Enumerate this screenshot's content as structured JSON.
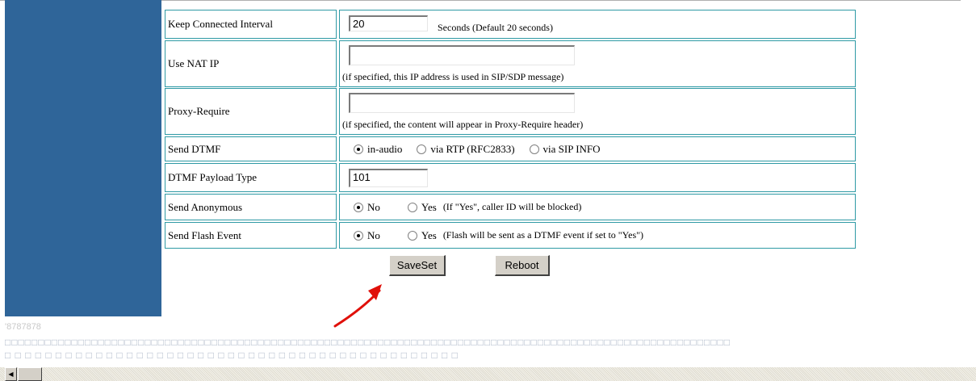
{
  "form": {
    "keep_connected": {
      "label": "Keep Connected Interval",
      "value": "20",
      "suffix": "Seconds (Default 20 seconds)"
    },
    "use_nat_ip": {
      "label": "Use NAT IP",
      "value": "",
      "hint": "(if specified, this IP address is used in SIP/SDP message)"
    },
    "proxy_require": {
      "label": "Proxy-Require",
      "value": "",
      "hint": "(if specified, the content will appear in Proxy-Require header)"
    },
    "send_dtmf": {
      "label": "Send DTMF",
      "options": [
        "in-audio",
        "via RTP (RFC2833)",
        "via SIP INFO"
      ],
      "selected": "in-audio"
    },
    "dtmf_payload_type": {
      "label": "DTMF Payload Type",
      "value": "101"
    },
    "send_anonymous": {
      "label": "Send Anonymous",
      "options": [
        "No",
        "Yes"
      ],
      "selected": "No",
      "note": "(If \"Yes\", caller ID will be blocked)"
    },
    "send_flash_event": {
      "label": "Send Flash Event",
      "options": [
        "No",
        "Yes"
      ],
      "selected": "No",
      "note": "(Flash will be sent as a DTMF event if set to \"Yes\")"
    }
  },
  "buttons": {
    "save": "SaveSet",
    "reboot": "Reboot"
  },
  "footer": {
    "junk_text": "'8787878"
  },
  "colors": {
    "sidebar": "#2f6599",
    "cell_border": "#2f9aa5",
    "annotation_arrow": "#e0100a"
  },
  "icons": {
    "annotation": "red-arrow-icon",
    "scroll_left": "scroll-left-arrow-icon"
  }
}
